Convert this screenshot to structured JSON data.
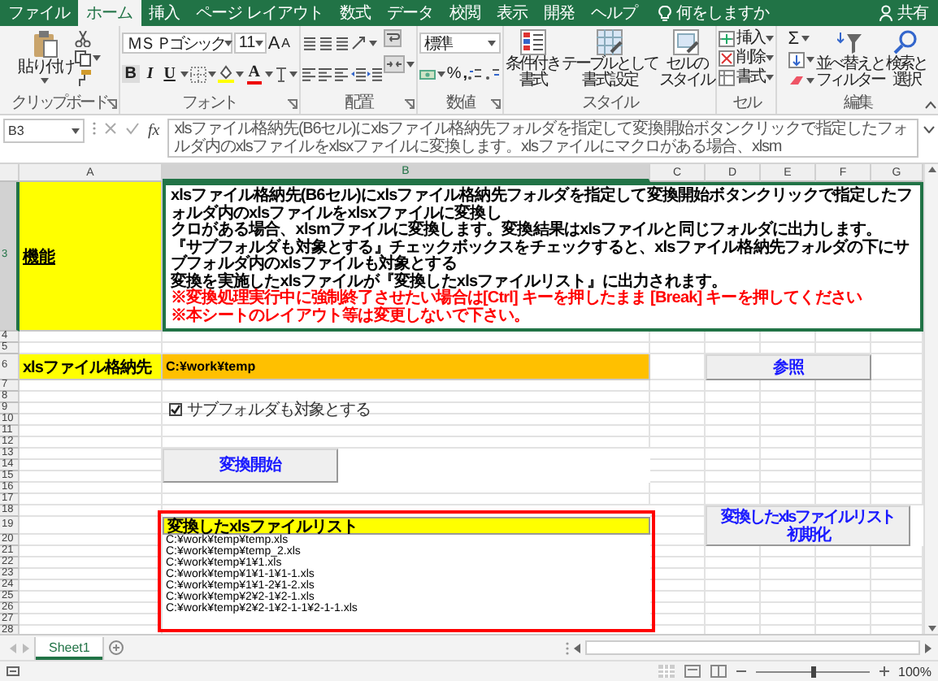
{
  "ribbon_tabs": [
    {
      "label": "ファイル",
      "selected": false
    },
    {
      "label": "ホーム",
      "selected": true
    },
    {
      "label": "挿入",
      "selected": false
    },
    {
      "label": "ページ レイアウト",
      "selected": false
    },
    {
      "label": "数式",
      "selected": false
    },
    {
      "label": "データ",
      "selected": false
    },
    {
      "label": "校閲",
      "selected": false
    },
    {
      "label": "表示",
      "selected": false
    },
    {
      "label": "開発",
      "selected": false
    },
    {
      "label": "ヘルプ",
      "selected": false
    }
  ],
  "tell_me": {
    "placeholder": "何をしますか"
  },
  "share": "共有",
  "ribbon": {
    "clipboard": {
      "label": "クリップボード",
      "paste": "貼り付け"
    },
    "font": {
      "label": "フォント",
      "name": "ＭＳ Ｐゴシック",
      "size": "11",
      "grow": "A",
      "shrink": "A",
      "bold": "B",
      "italic": "I",
      "underline": "U",
      "font_color_button": "A"
    },
    "alignment": {
      "label": "配置"
    },
    "number": {
      "label": "数値",
      "format": "標準",
      "percent": "%",
      "comma": ","
    },
    "styles": {
      "label": "スタイル",
      "buttons": [
        {
          "lines": [
            "条件付き",
            "書式"
          ]
        },
        {
          "lines": [
            "テーブルとして",
            "書式設定"
          ]
        },
        {
          "lines": [
            "セルの",
            "スタイル"
          ]
        }
      ]
    },
    "cells": {
      "label": "セル",
      "buttons": [
        "挿入",
        "削除",
        "書式"
      ]
    },
    "editing": {
      "label": "編集",
      "sum": "Σ",
      "buttons": [
        {
          "lines": [
            "並べ替えと",
            "フィルター"
          ]
        },
        {
          "lines": [
            "検索と",
            "選択"
          ]
        }
      ]
    }
  },
  "formula_bar": {
    "name_box": "B3",
    "fx": "fx",
    "formula": "xlsファイル格納先(B6セル)にxlsファイル格納先フォルダを指定して変換開始ボタンクリックで指定したフォルダ内のxlsファイルをxlsxファイルに変換します。xlsファイルにマクロがある場合、xlsm"
  },
  "sheet": {
    "columns": [
      {
        "label": "A",
        "selected": false
      },
      {
        "label": "B",
        "selected": true
      },
      {
        "label": "C",
        "selected": false
      },
      {
        "label": "D",
        "selected": false
      },
      {
        "label": "E",
        "selected": false
      },
      {
        "label": "F",
        "selected": false
      },
      {
        "label": "G",
        "selected": false
      }
    ],
    "rows": [
      {
        "number": "3",
        "selected": true,
        "cell_a": {
          "kind": "title",
          "text": "機能",
          "color": "#ffff00"
        },
        "cell_b": {
          "kind": "description",
          "lines": [
            {
              "kind": "normal",
              "text": "xlsファイル格納先(B6セル)にxlsファイル格納先フォルダを指定して変換開始ボタンクリックで指定したフォルダ内のxlsファイルをxlsxファイルに変換し"
            },
            {
              "kind": "normal",
              "text": "クロがある場合、xlsmファイルに変換します。変換結果はxlsファイルと同じフォルダに出力します。"
            },
            {
              "kind": "normal",
              "text": "『サブフォルダも対象とする』チェックボックスをチェックすると、xlsファイル格納先フォルダの下にサブフォルダ内のxlsファイルも対象とする"
            },
            {
              "kind": "normal",
              "text": "変換を実施したxlsファイルが『変換したxlsファイルリスト』に出力されます。"
            },
            {
              "kind": "warning",
              "text": "※変換処理実行中に強制終了させたい場合は[Ctrl] キーを押したまま [Break] キーを押してください"
            },
            {
              "kind": "warning",
              "text": "※本シートのレイアウト等は変更しないで下さい。"
            }
          ]
        }
      },
      {
        "number": "4",
        "selected": false
      },
      {
        "number": "5",
        "selected": false
      },
      {
        "number": "6",
        "selected": false,
        "cell_a": {
          "kind": "label",
          "text": "xlsファイル格納先",
          "color": "#ffff00"
        },
        "cell_b": {
          "kind": "input",
          "text": "C:¥work¥temp",
          "color": "#ffc000"
        }
      },
      {
        "number": "7",
        "selected": false
      },
      {
        "number": "8",
        "selected": false
      },
      {
        "number": "9",
        "selected": false
      },
      {
        "number": "10",
        "selected": false
      },
      {
        "number": "11",
        "selected": false
      },
      {
        "number": "12",
        "selected": false
      },
      {
        "number": "13",
        "selected": false
      },
      {
        "number": "14",
        "selected": false
      },
      {
        "number": "15",
        "selected": false
      },
      {
        "number": "16",
        "selected": false
      },
      {
        "number": "17",
        "selected": false
      },
      {
        "number": "18",
        "selected": false
      },
      {
        "number": "19",
        "selected": false,
        "cell_b": {
          "kind": "list_header",
          "text": "変換したxlsファイルリスト",
          "color": "#ffff00"
        }
      },
      {
        "number": "20",
        "selected": false,
        "cell_b": {
          "kind": "list_item",
          "text": "C:¥work¥temp¥temp.xls"
        }
      },
      {
        "number": "21",
        "selected": false,
        "cell_b": {
          "kind": "list_item",
          "text": "C:¥work¥temp¥temp_2.xls"
        }
      },
      {
        "number": "22",
        "selected": false,
        "cell_b": {
          "kind": "list_item",
          "text": "C:¥work¥temp¥1¥1.xls"
        }
      },
      {
        "number": "23",
        "selected": false,
        "cell_b": {
          "kind": "list_item",
          "text": "C:¥work¥temp¥1¥1-1¥1-1.xls"
        }
      },
      {
        "number": "24",
        "selected": false,
        "cell_b": {
          "kind": "list_item",
          "text": "C:¥work¥temp¥1¥1-2¥1-2.xls"
        }
      },
      {
        "number": "25",
        "selected": false,
        "cell_b": {
          "kind": "list_item",
          "text": "C:¥work¥temp¥2¥2-1¥2-1.xls"
        }
      },
      {
        "number": "26",
        "selected": false,
        "cell_b": {
          "kind": "list_item",
          "text": "C:¥work¥temp¥2¥2-1¥2-1-1¥2-1-1.xls"
        }
      },
      {
        "number": "27",
        "selected": false
      },
      {
        "number": "28",
        "selected": false
      }
    ],
    "checkbox": {
      "label": "サブフォルダも対象とする",
      "checked": true
    },
    "buttons": [
      {
        "lines": [
          "参照"
        ]
      },
      {
        "lines": [
          "変換開始"
        ]
      },
      {
        "lines": [
          "変換したxlsファイルリスト",
          "初期化"
        ]
      }
    ]
  },
  "sheet_tabs": [
    {
      "label": "Sheet1",
      "selected": true
    }
  ],
  "status_bar": {
    "zoom": {
      "level": 0.5,
      "label": "100%"
    }
  }
}
